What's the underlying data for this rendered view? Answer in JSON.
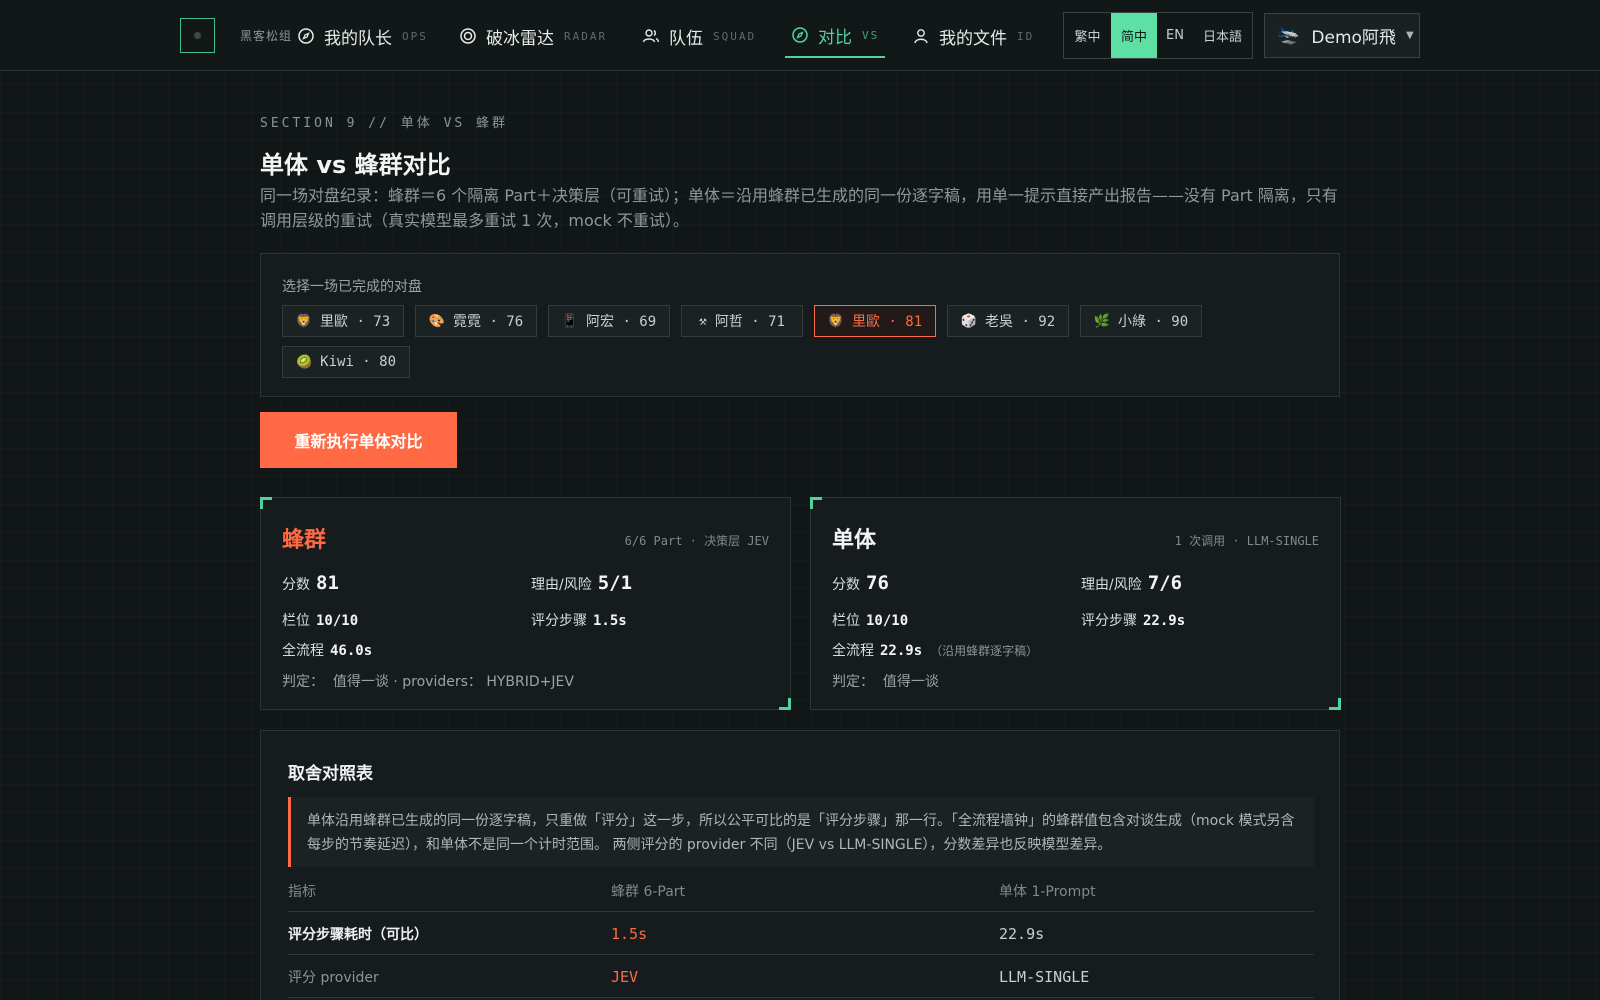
{
  "nav": {
    "brand": "黑客松组",
    "items": [
      {
        "label": "我的队长",
        "sub": "OPS",
        "icon": "compass-icon"
      },
      {
        "label": "破冰雷达",
        "sub": "RADAR",
        "icon": "radar-icon"
      },
      {
        "label": "队伍",
        "sub": "SQUAD",
        "icon": "users-icon"
      },
      {
        "label": "对比",
        "sub": "VS",
        "icon": "compass-icon",
        "active": true
      },
      {
        "label": "我的文件",
        "sub": "ID",
        "icon": "user-icon"
      }
    ],
    "languages": [
      "繁中",
      "简中",
      "EN",
      "日本語"
    ],
    "active_language": "简中",
    "user": {
      "avatar": "🛬",
      "name": "Demo阿飛",
      "caret": "▼"
    }
  },
  "header": {
    "section": "SECTION 9 // 单体 VS 蜂群",
    "title": "单体 vs 蜂群对比",
    "description": "同一场对盘纪录：蜂群＝6 个隔离 Part＋决策层（可重试）；单体＝沿用蜂群已生成的同一份逐字稿，用单一提示直接产出报告——没有 Part 隔离，只有调用层级的重试（真实模型最多重试 1 次，mock 不重试）。"
  },
  "selector": {
    "label": "选择一场已完成的对盘",
    "chips": [
      {
        "emoji": "🦁",
        "text": "里歐 · 73"
      },
      {
        "emoji": "🎨",
        "text": "霓霓 · 76"
      },
      {
        "emoji": "📱",
        "text": "阿宏 · 69"
      },
      {
        "emoji": "⚒",
        "text": "阿哲 · 71"
      },
      {
        "emoji": "🦁",
        "text": "里歐 · 81",
        "active": true
      },
      {
        "emoji": "🎲",
        "text": "老吳 · 92"
      },
      {
        "emoji": "🌿",
        "text": "小綠 · 90"
      },
      {
        "emoji": "🥝",
        "text": "Kiwi · 80"
      }
    ]
  },
  "actions": {
    "rerun_label": "重新执行单体对比"
  },
  "swarm": {
    "title": "蜂群",
    "meta": "6/6 Part · 决策层 JEV",
    "score_label": "分数",
    "score": "81",
    "reason_label": "理由/风险",
    "reason": "5/1",
    "slots_label": "栏位",
    "slots": "10/10",
    "step_label": "评分步骤",
    "step": "1.5s",
    "total_label": "全流程",
    "total": "46.0s",
    "verdict_label": "判定：",
    "verdict": "值得一谈 · providers： HYBRID+JEV"
  },
  "single": {
    "title": "单体",
    "meta": "1 次调用 · LLM-SINGLE",
    "score_label": "分数",
    "score": "76",
    "reason_label": "理由/风险",
    "reason": "7/6",
    "slots_label": "栏位",
    "slots": "10/10",
    "step_label": "评分步骤",
    "step": "22.9s",
    "total_label": "全流程",
    "total": "22.9s",
    "total_note": "（沿用蜂群逐字稿）",
    "verdict_label": "判定：",
    "verdict": "值得一谈"
  },
  "comparison": {
    "title": "取舍对照表",
    "note": "单体沿用蜂群已生成的同一份逐字稿，只重做「评分」这一步，所以公平可比的是「评分步骤」那一行。「全流程墙钟」的蜂群值包含对谈生成（mock 模式另含每步的节奏延迟），和单体不是同一个计时范围。 两侧评分的 provider 不同（JEV vs LLM-SINGLE），分数差异也反映模型差异。",
    "headers": [
      "指标",
      "蜂群 6-Part",
      "单体 1-Prompt"
    ],
    "rows": [
      [
        "评分步骤耗时（可比）",
        "1.5s",
        "22.9s"
      ],
      [
        "评分 provider",
        "JEV",
        "LLM-SINGLE"
      ]
    ]
  },
  "colors": {
    "accent": "#52d39b",
    "alert": "#ff6a44",
    "background": "#111617"
  }
}
